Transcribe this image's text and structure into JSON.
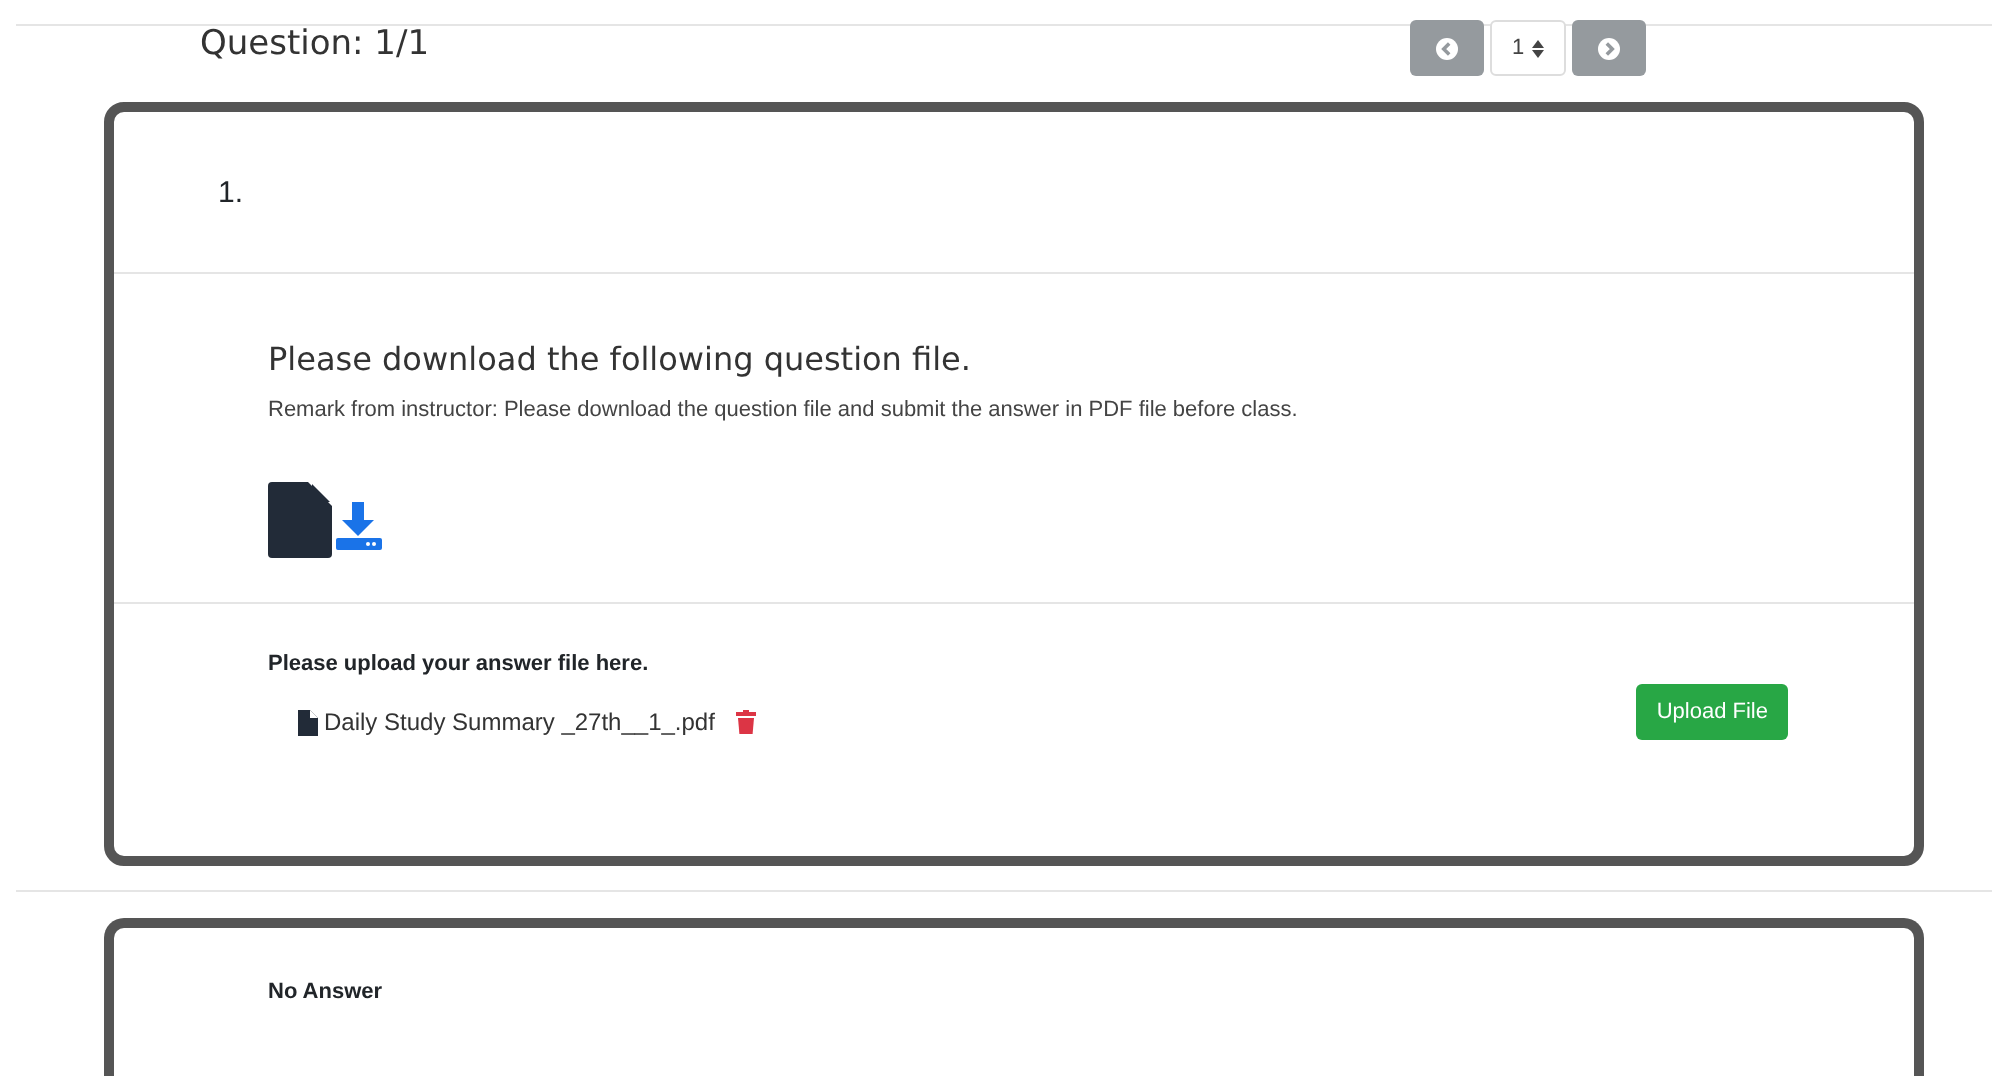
{
  "header": {
    "title": "Question: 1/1"
  },
  "pager": {
    "page": "1"
  },
  "question": {
    "number": "1.",
    "prompt": "Please download the following question file.",
    "remark": "Remark from instructor: Please download the question file and submit the answer in PDF file before class."
  },
  "upload": {
    "label": "Please upload your answer file here.",
    "files": [
      "Daily Study Summary _27th__1_.pdf"
    ],
    "button": "Upload File"
  },
  "answer": {
    "text": "No Answer"
  }
}
